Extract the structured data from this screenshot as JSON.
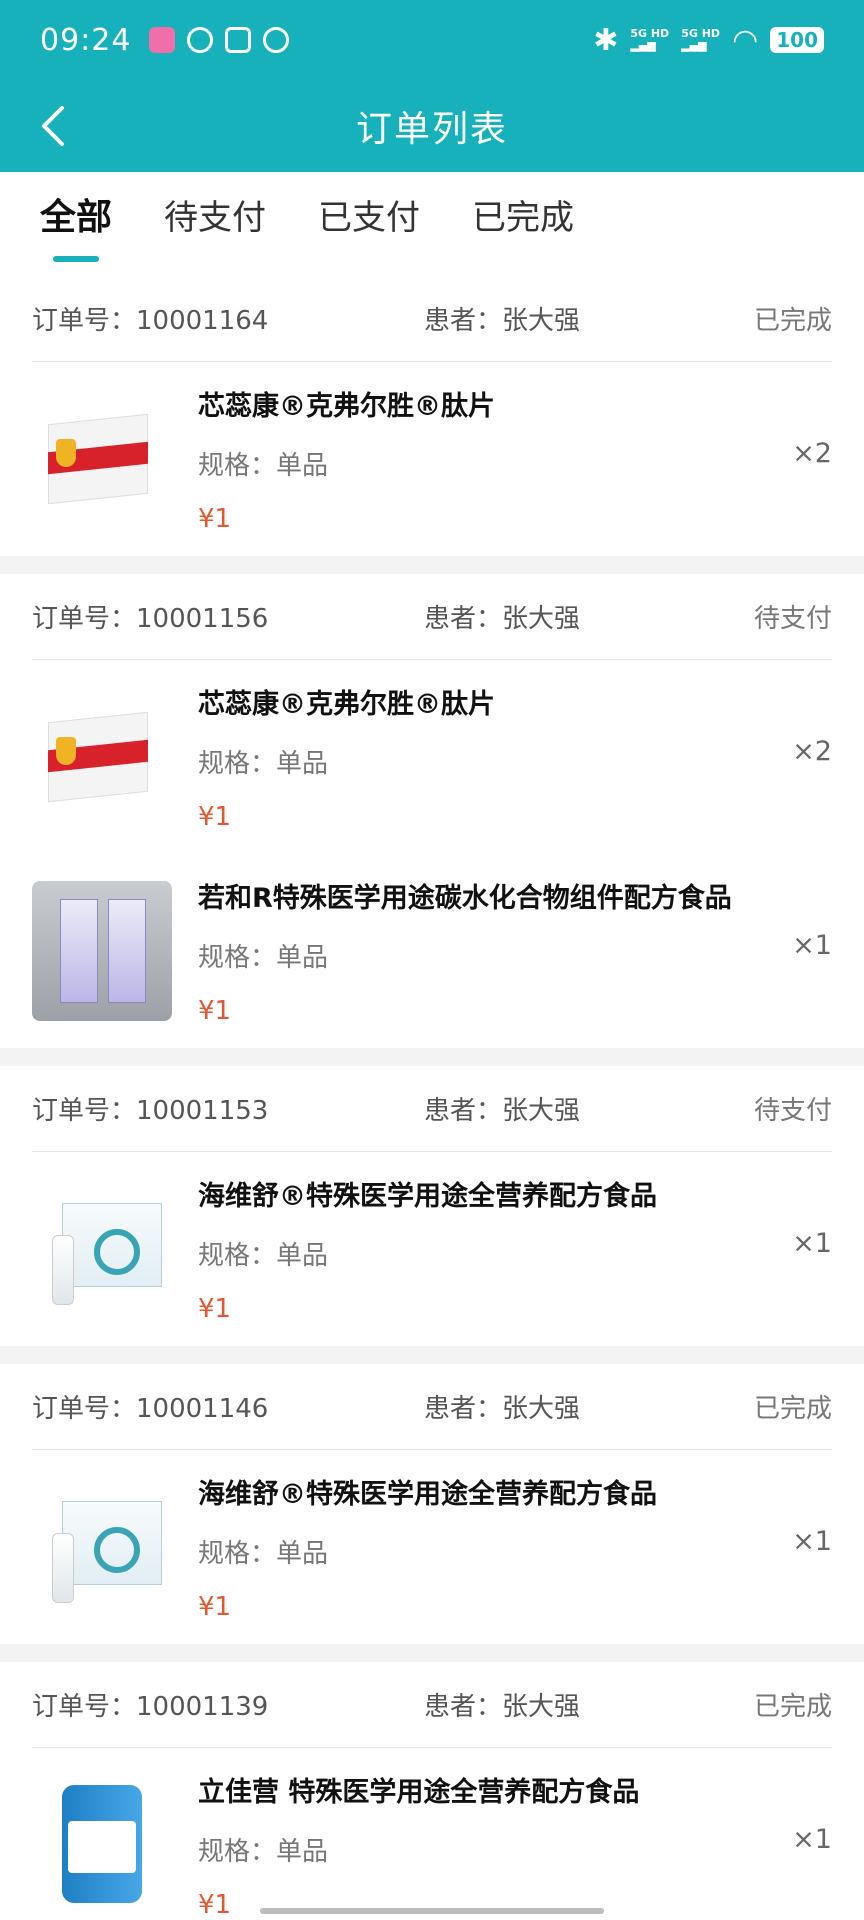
{
  "status_bar": {
    "time": "09:24",
    "battery": "100"
  },
  "header": {
    "title": "订单列表"
  },
  "tabs": [
    {
      "label": "全部",
      "active": true
    },
    {
      "label": "待支付"
    },
    {
      "label": "已支付"
    },
    {
      "label": "已完成"
    }
  ],
  "labels": {
    "order_no": "订单号：",
    "patient": "患者：",
    "spec": "规格："
  },
  "orders": [
    {
      "order_no": "10001164",
      "patient": "张大强",
      "status": "已完成",
      "items": [
        {
          "name": "芯蕊康®克弗尔胜®肽片",
          "spec": "单品",
          "price": "¥1",
          "qty": "×2"
        }
      ]
    },
    {
      "order_no": "10001156",
      "patient": "张大强",
      "status": "待支付",
      "items": [
        {
          "name": "芯蕊康®克弗尔胜®肽片",
          "spec": "单品",
          "price": "¥1",
          "qty": "×2"
        },
        {
          "name": "若和R特殊医学用途碳水化合物组件配方食品",
          "spec": "单品",
          "price": "¥1",
          "qty": "×1"
        }
      ]
    },
    {
      "order_no": "10001153",
      "patient": "张大强",
      "status": "待支付",
      "items": [
        {
          "name": "海维舒®特殊医学用途全营养配方食品",
          "spec": "单品",
          "price": "¥1",
          "qty": "×1"
        }
      ]
    },
    {
      "order_no": "10001146",
      "patient": "张大强",
      "status": "已完成",
      "items": [
        {
          "name": "海维舒®特殊医学用途全营养配方食品",
          "spec": "单品",
          "price": "¥1",
          "qty": "×1"
        }
      ]
    },
    {
      "order_no": "10001139",
      "patient": "张大强",
      "status": "已完成",
      "items": [
        {
          "name": "立佳营 特殊医学用途全营养配方食品",
          "spec": "单品",
          "price": "¥1",
          "qty": "×1"
        }
      ]
    }
  ],
  "colors": {
    "primary": "#17b1bc",
    "price": "#e4572e"
  }
}
